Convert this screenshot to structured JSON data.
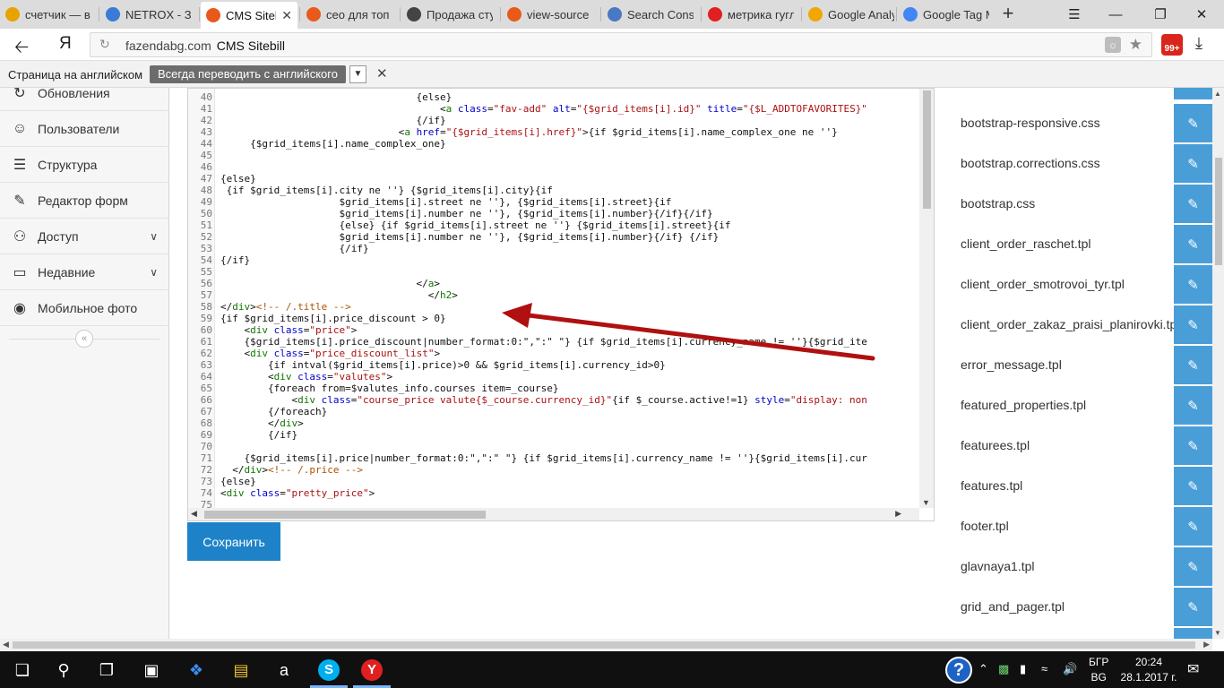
{
  "tabs": [
    {
      "title": "счетчик — в",
      "icon": "bar-chart-icon",
      "color": "#e8a300"
    },
    {
      "title": "NETROX - Зс",
      "icon": "netrox-icon",
      "color": "#3a7bd5"
    },
    {
      "title": "CMS Siteb",
      "icon": "sitebill-icon",
      "color": "#e8591a",
      "active": true
    },
    {
      "title": "сео для топ",
      "icon": "sitebill-icon",
      "color": "#e8591a"
    },
    {
      "title": "Продажа сту",
      "icon": "house-icon",
      "color": "#444444"
    },
    {
      "title": "view-source",
      "icon": "sitebill-icon",
      "color": "#e8591a"
    },
    {
      "title": "Search Consc",
      "icon": "search-console-icon",
      "color": "#4a78c2"
    },
    {
      "title": "метрика гугл",
      "icon": "yandex-icon",
      "color": "#e02020"
    },
    {
      "title": "Google Analy",
      "icon": "analytics-icon",
      "color": "#f2a600"
    },
    {
      "title": "Google Tag M",
      "icon": "tag-manager-icon",
      "color": "#4285f4"
    }
  ],
  "address": {
    "domain": "fazendabg.com",
    "page_title": "CMS Sitebill",
    "browser_logo": "Я"
  },
  "extension_badge": "99+",
  "translate": {
    "prompt": "Страница на английском",
    "always_label": "Всегда переводить с английского"
  },
  "sidebar": {
    "items": [
      {
        "label": "Обновления",
        "icon": "refresh-icon"
      },
      {
        "label": "Пользователи",
        "icon": "user-icon"
      },
      {
        "label": "Структура",
        "icon": "list-icon"
      },
      {
        "label": "Редактор форм",
        "icon": "edit-icon"
      },
      {
        "label": "Доступ",
        "icon": "users-icon",
        "expandable": true
      },
      {
        "label": "Недавние",
        "icon": "monitor-icon",
        "expandable": true
      },
      {
        "label": "Мобильное фото",
        "icon": "camera-icon"
      }
    ]
  },
  "code_lines": [
    {
      "n": "40",
      "html": "                                 {else}"
    },
    {
      "n": "41",
      "html": "                                     &lt;<span class=\"tag\">a</span> <span class=\"attr\">class</span>=<span class=\"str\">\"fav-add\"</span> <span class=\"attr\">alt</span>=<span class=\"str\">\"{$grid_items[i].id}\"</span> <span class=\"attr\">title</span>=<span class=\"str\">\"{$L_ADDTOFAVORITES}\"</span>"
    },
    {
      "n": "42",
      "html": "                                 {/if}"
    },
    {
      "n": "43",
      "html": "                              &lt;<span class=\"tag\">a</span> <span class=\"attr\">href</span>=<span class=\"str\">\"{$grid_items[i].href}\"</span>&gt;{if $grid_items[i].name_complex_one ne ''}"
    },
    {
      "n": "44",
      "html": "     {$grid_items[i].name_complex_one}"
    },
    {
      "n": "45",
      "html": ""
    },
    {
      "n": "46",
      "html": ""
    },
    {
      "n": "47",
      "html": "{else}"
    },
    {
      "n": "48",
      "html": " {if $grid_items[i].city ne ''} {$grid_items[i].city}{if"
    },
    {
      "n": "49",
      "html": "                    $grid_items[i].street ne ''}, {$grid_items[i].street}{if"
    },
    {
      "n": "50",
      "html": "                    $grid_items[i].number ne ''}, {$grid_items[i].number}{/if}{/if}"
    },
    {
      "n": "51",
      "html": "                    {else} {if $grid_items[i].street ne ''} {$grid_items[i].street}{if"
    },
    {
      "n": "52",
      "html": "                    $grid_items[i].number ne ''}, {$grid_items[i].number}{/if} {/if}"
    },
    {
      "n": "53",
      "html": "                    {/if}"
    },
    {
      "n": "54",
      "html": "{/if}"
    },
    {
      "n": "55",
      "html": ""
    },
    {
      "n": "56",
      "html": "                                 &lt;/<span class=\"tag\">a</span>&gt;"
    },
    {
      "n": "57",
      "html": "                                   &lt;/<span class=\"tag\">h2</span>&gt;"
    },
    {
      "n": "58",
      "html": "&lt;/<span class=\"tag\">div</span>&gt;<span class=\"cmt\">&lt;!-- /.title --&gt;</span>"
    },
    {
      "n": "59",
      "html": "{if $grid_items[i].price_discount &gt; 0}"
    },
    {
      "n": "60",
      "html": "    &lt;<span class=\"tag\">div</span> <span class=\"attr\">class</span>=<span class=\"str\">\"price\"</span>&gt;"
    },
    {
      "n": "61",
      "html": "    {$grid_items[i].price_discount|number_format:0:\",\":\" \"} {if $grid_items[i].currency_name != ''}{$grid_ite"
    },
    {
      "n": "62",
      "html": "    &lt;<span class=\"tag\">div</span> <span class=\"attr\">class</span>=<span class=\"str\">\"price_discount_list\"</span>&gt;"
    },
    {
      "n": "63",
      "html": "        {if intval($grid_items[i].price)&gt;0 &amp;&amp; $grid_items[i].currency_id&gt;0}"
    },
    {
      "n": "64",
      "html": "        &lt;<span class=\"tag\">div</span> <span class=\"attr\">class</span>=<span class=\"str\">\"valutes\"</span>&gt;"
    },
    {
      "n": "65",
      "html": "        {foreach from=$valutes_info.courses item=_course}"
    },
    {
      "n": "66",
      "html": "            &lt;<span class=\"tag\">div</span> <span class=\"attr\">class</span>=<span class=\"str\">\"course_price valute{$_course.currency_id}\"</span>{if $_course.active!=1} <span class=\"attr\">style</span>=<span class=\"str\">\"display: non</span>"
    },
    {
      "n": "67",
      "html": "        {/foreach}"
    },
    {
      "n": "68",
      "html": "        &lt;/<span class=\"tag\">div</span>&gt;"
    },
    {
      "n": "69",
      "html": "        {/if}"
    },
    {
      "n": "70",
      "html": ""
    },
    {
      "n": "71",
      "html": "    {$grid_items[i].price|number_format:0:\",\":\" \"} {if $grid_items[i].currency_name != ''}{$grid_items[i].cur"
    },
    {
      "n": "72",
      "html": "  &lt;/<span class=\"tag\">div</span>&gt;<span class=\"cmt\">&lt;!-- /.price --&gt;</span>"
    },
    {
      "n": "73",
      "html": "{else}"
    },
    {
      "n": "74",
      "html": "&lt;<span class=\"tag\">div</span> <span class=\"attr\">class</span>=<span class=\"str\">\"pretty_price\"</span>&gt;"
    },
    {
      "n": "75",
      "html": ""
    }
  ],
  "save_label": "Сохранить",
  "files": [
    "bootstrap-responsive.css",
    "bootstrap.corrections.css",
    "bootstrap.css",
    "client_order_raschet.tpl",
    "client_order_smotrovoi_tyr.tpl",
    "client_order_zakaz_praisi_planirovki.tpl",
    "error_message.tpl",
    "featured_properties.tpl",
    "featurees.tpl",
    "features.tpl",
    "footer.tpl",
    "glavnaya1.tpl",
    "grid_and_pager.tpl"
  ],
  "taskbar": {
    "lang_top": "БГР",
    "lang_bottom": "BG",
    "time": "20:24",
    "date": "28.1.2017 г."
  },
  "colors": {
    "accent": "#1e82c8",
    "edit_button": "#4a9ed8",
    "arrow": "#b01010"
  }
}
